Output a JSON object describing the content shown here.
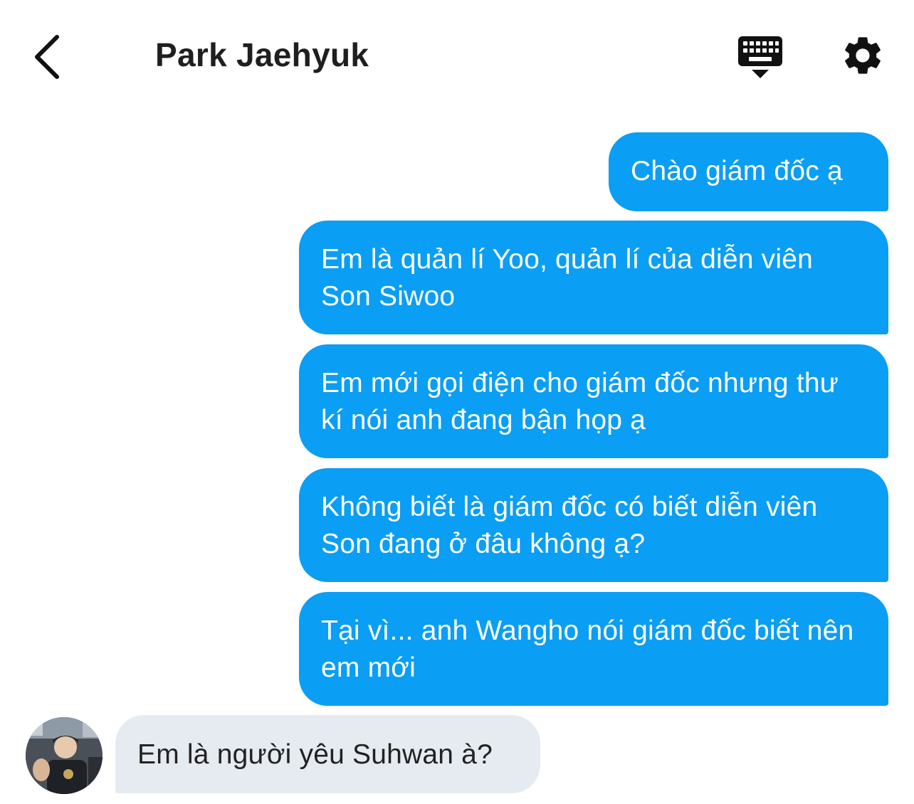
{
  "header": {
    "contact_name": "Park Jaehyuk",
    "back_icon": "chevron-left-icon",
    "keyboard_icon": "keyboard-icon",
    "settings_icon": "gear-icon"
  },
  "colors": {
    "outgoing_bubble": "#0a9ef5",
    "incoming_bubble": "#e6ebf1",
    "background": "#ffffff"
  },
  "messages": [
    {
      "direction": "outgoing",
      "text": "Chào giám đốc ạ"
    },
    {
      "direction": "outgoing",
      "text": "Em là quản lí Yoo, quản lí của diễn viên Son Siwoo"
    },
    {
      "direction": "outgoing",
      "text": "Em mới gọi điện cho giám đốc nhưng thư kí nói anh đang bận họp ạ"
    },
    {
      "direction": "outgoing",
      "text": "Không biết là giám đốc có biết diễn viên Son đang ở đâu không ạ?"
    },
    {
      "direction": "outgoing",
      "text": "Tại vì... anh Wangho nói giám đốc biết nên em mới"
    },
    {
      "direction": "incoming",
      "text": "Em là người yêu Suhwan à?"
    }
  ]
}
